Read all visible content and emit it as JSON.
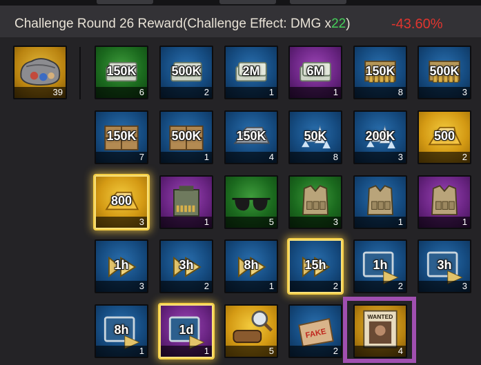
{
  "header": {
    "title_prefix": "Challenge Round 26 Reward(Challenge Effect: DMG x",
    "title_multiplier": "22",
    "title_suffix": ")",
    "damage_percent": "-43.60%"
  },
  "colors": {
    "green": "#1b6a1e",
    "blue": "#154b80",
    "purple": "#6b2584",
    "gold": "#d49a14",
    "highlight": "#46d15a",
    "negative": "#e0352f",
    "selection": "#a04fb0"
  },
  "chest": {
    "icon": "loot-bag-icon",
    "count": "39"
  },
  "rows": [
    [
      {
        "label": "150K",
        "count": "6",
        "icon": "cash-stack-icon",
        "bg": "green"
      },
      {
        "label": "500K",
        "count": "2",
        "icon": "cash-stack-icon",
        "bg": "blue"
      },
      {
        "label": "2M",
        "count": "1",
        "icon": "cash-stack-icon",
        "bg": "blue"
      },
      {
        "label": "6M",
        "count": "1",
        "icon": "cash-stack-icon",
        "bg": "purple"
      },
      {
        "label": "150K",
        "count": "8",
        "icon": "ammo-box-icon",
        "bg": "blue"
      },
      {
        "label": "500K",
        "count": "3",
        "icon": "ammo-box-icon",
        "bg": "blue"
      }
    ],
    [
      {
        "label": "150K",
        "count": "7",
        "icon": "supply-crate-icon",
        "bg": "blue"
      },
      {
        "label": "500K",
        "count": "1",
        "icon": "supply-crate-icon",
        "bg": "blue"
      },
      {
        "label": "150K",
        "count": "4",
        "icon": "metal-ingot-icon",
        "bg": "blue"
      },
      {
        "label": "50K",
        "count": "8",
        "icon": "crystal-icon",
        "bg": "blue"
      },
      {
        "label": "200K",
        "count": "3",
        "icon": "crystal-icon",
        "bg": "blue"
      },
      {
        "label": "500",
        "count": "2",
        "icon": "gold-bar-icon",
        "bg": "gold"
      }
    ],
    [
      {
        "label": "800",
        "count": "3",
        "icon": "gold-bar-icon",
        "bg": "gold",
        "glow": true
      },
      {
        "label": "",
        "count": "1",
        "icon": "ammo-can-icon",
        "bg": "purple"
      },
      {
        "label": "",
        "count": "5",
        "icon": "sunglasses-icon",
        "bg": "green"
      },
      {
        "label": "",
        "count": "3",
        "icon": "tactical-vest-icon",
        "bg": "green"
      },
      {
        "label": "",
        "count": "1",
        "icon": "tactical-vest-icon",
        "bg": "blue"
      },
      {
        "label": "",
        "count": "1",
        "icon": "tactical-vest-icon",
        "bg": "purple"
      }
    ],
    [
      {
        "label": "1h",
        "count": "3",
        "icon": "speedup-arrow-icon",
        "bg": "blue"
      },
      {
        "label": "3h",
        "count": "2",
        "icon": "speedup-arrow-icon",
        "bg": "blue"
      },
      {
        "label": "8h",
        "count": "1",
        "icon": "speedup-arrow-icon",
        "bg": "blue"
      },
      {
        "label": "15h",
        "count": "2",
        "icon": "speedup-arrow-icon",
        "bg": "blue",
        "glow": true
      },
      {
        "label": "1h",
        "count": "2",
        "icon": "speedup-tablet-icon",
        "bg": "blue"
      },
      {
        "label": "3h",
        "count": "3",
        "icon": "speedup-tablet-icon",
        "bg": "blue"
      }
    ],
    [
      {
        "label": "8h",
        "count": "1",
        "icon": "speedup-tablet-icon",
        "bg": "blue"
      },
      {
        "label": "1d",
        "count": "1",
        "icon": "speedup-tablet-icon",
        "bg": "purple",
        "glow": true
      },
      {
        "label": "",
        "count": "5",
        "icon": "magnifier-scroll-icon",
        "bg": "gold"
      },
      {
        "label": "",
        "count": "2",
        "icon": "fake-stamp-icon",
        "bg": "blue",
        "stamp": "FAKE"
      },
      {
        "label": "",
        "count": "4",
        "icon": "wanted-poster-icon",
        "bg": "gold-dark",
        "poster": "WANTED"
      }
    ]
  ]
}
